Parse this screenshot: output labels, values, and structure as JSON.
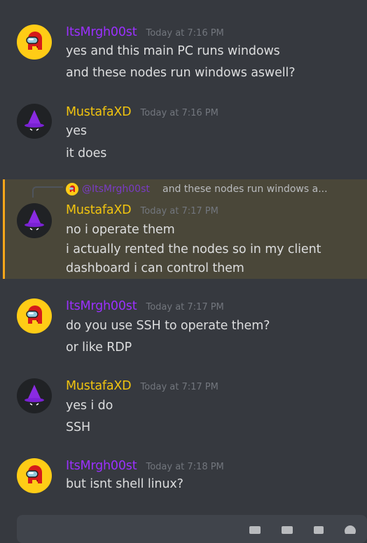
{
  "messages": [
    {
      "author": "ItsMrgh00st",
      "timestamp": "Today at 7:16 PM",
      "lines": [
        "yes and this main PC runs windows",
        "and these nodes run windows aswell?"
      ]
    },
    {
      "author": "MustafaXD",
      "timestamp": "Today at 7:16 PM",
      "lines": [
        "yes",
        "it does"
      ]
    },
    {
      "reply": {
        "author": "@ItsMrgh00st",
        "text": "and these nodes run windows a..."
      },
      "author": "MustafaXD",
      "timestamp": "Today at 7:17 PM",
      "lines": [
        "no i operate them",
        "i actually rented the nodes so in my client",
        "dashboard i can control them"
      ]
    },
    {
      "author": "ItsMrgh00st",
      "timestamp": "Today at 7:17 PM",
      "lines": [
        "do you use SSH to operate them?",
        "or like RDP"
      ]
    },
    {
      "author": "MustafaXD",
      "timestamp": "Today at 7:17 PM",
      "lines": [
        "yes i do",
        "SSH"
      ]
    },
    {
      "author": "ItsMrgh00st",
      "timestamp": "Today at 7:18 PM",
      "lines": [
        "but isnt shell linux?"
      ]
    }
  ],
  "colors": {
    "background": "#36393f",
    "mention_highlight": "#4a4739",
    "mention_bar": "#faa61a",
    "user_itsmrgh00st": "#9b30ff",
    "user_mustafaxd": "#f1c40f"
  },
  "icons": {
    "among_us_avatar": "among-us-crewmate-avatar",
    "wizard_avatar": "purple-wizard-hat-avatar"
  }
}
